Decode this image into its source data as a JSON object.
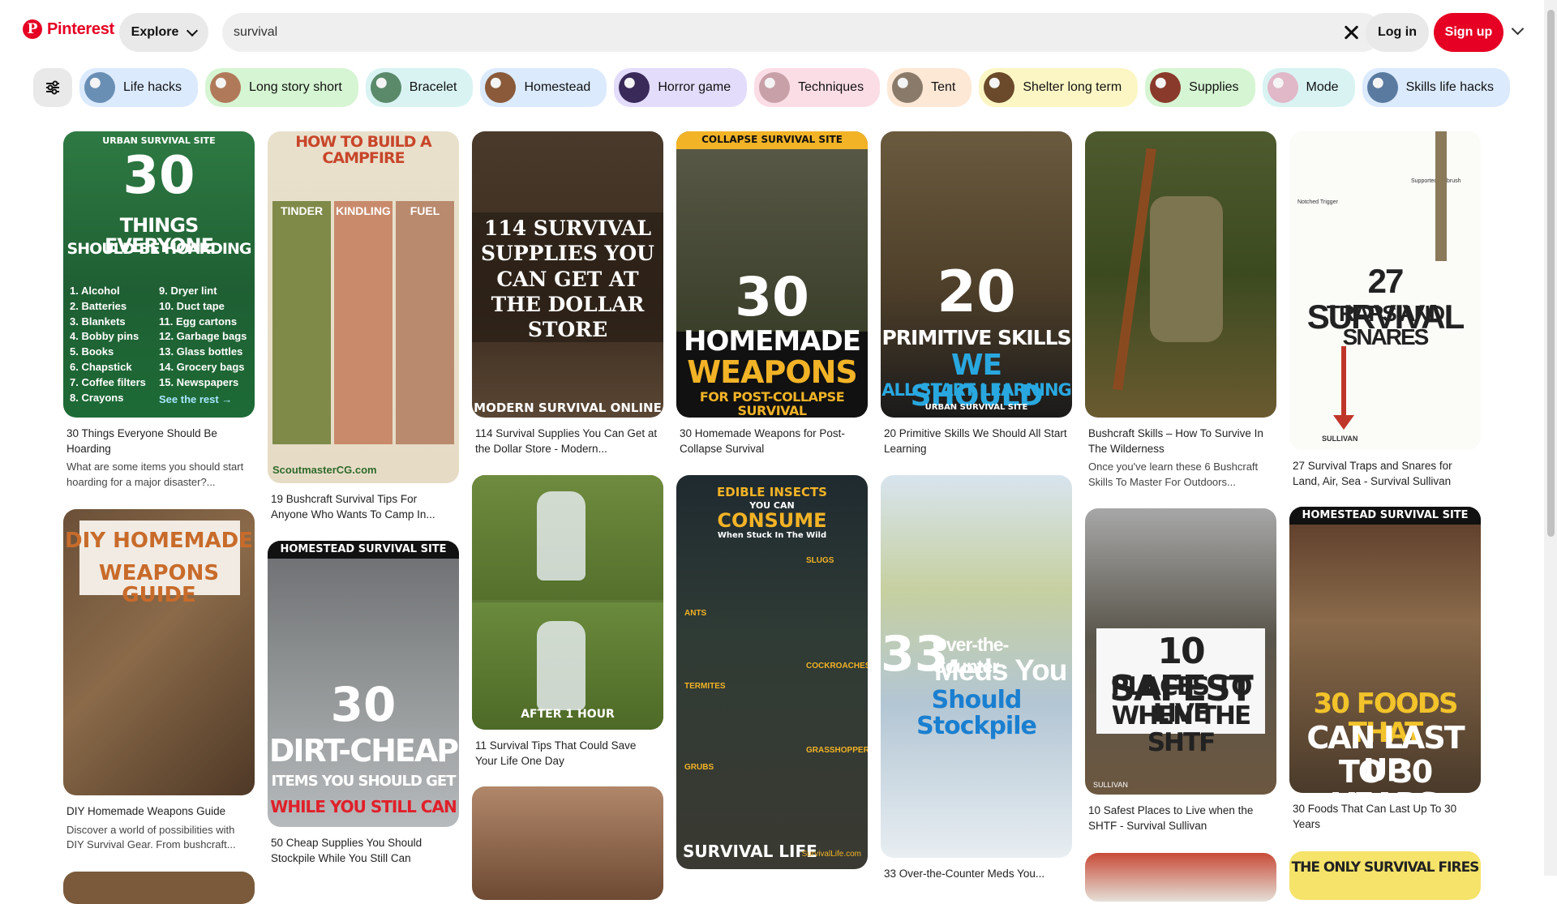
{
  "header": {
    "logo_glyph": "P",
    "logo_text": "Pinterest",
    "explore_label": "Explore",
    "search_value": "survival",
    "login_label": "Log in",
    "signup_label": "Sign up"
  },
  "chips": [
    {
      "label": "Life hacks",
      "bg": "#dbeafd"
    },
    {
      "label": "Long story short",
      "bg": "#d6f5d3"
    },
    {
      "label": "Bracelet",
      "bg": "#d9f3f3"
    },
    {
      "label": "Homestead",
      "bg": "#dbeafd"
    },
    {
      "label": "Horror game",
      "bg": "#e3dcfb"
    },
    {
      "label": "Techniques",
      "bg": "#fbdde6"
    },
    {
      "label": "Tent",
      "bg": "#fde8d6"
    },
    {
      "label": "Shelter long term",
      "bg": "#fbf6c4"
    },
    {
      "label": "Supplies",
      "bg": "#d6f5d3"
    },
    {
      "label": "Mode",
      "bg": "#d9f3f3"
    },
    {
      "label": "Skills life hacks",
      "bg": "#dbeafd"
    }
  ],
  "pins": {
    "p1": {
      "t1": "URBAN SURVIVAL SITE",
      "t2": "30",
      "t3": "THINGS EVERYONE",
      "t4": "SHOULD BE HOARDING",
      "l1": "1. Alcohol\n2. Batteries\n3. Blankets\n4. Bobby pins\n5. Books\n6. Chapstick\n7. Coffee filters\n8. Crayons",
      "l2": "9. Dryer lint\n10. Duct tape\n11. Egg cartons\n12. Garbage bags\n13. Glass bottles\n14. Grocery bags\n15. Newspapers",
      "more": "See the rest →",
      "title": "30 Things Everyone Should Be Hoarding",
      "desc": "What are some items you should start hoarding for a major disaster?..."
    },
    "p2": {
      "t1": "HOW TO BUILD A CAMPFIRE",
      "c1": "TINDER",
      "c2": "KINDLING",
      "c3": "FUEL",
      "foot": "ScoutmasterCG.com",
      "title": "19 Bushcraft Survival Tips For Anyone Who Wants To Camp In..."
    },
    "p3": {
      "t1": "114 SURVIVAL SUPPLIES YOU CAN GET AT THE DOLLAR STORE",
      "foot": "MODERN SURVIVAL ONLINE",
      "title": "114 Survival Supplies You Can Get at the Dollar Store - Modern..."
    },
    "p4": {
      "t1": "COLLAPSE SURVIVAL SITE",
      "t2": "30",
      "t3": "HOMEMADE",
      "t4": "WEAPONS",
      "t5": "FOR POST-COLLAPSE SURVIVAL",
      "title": "30 Homemade Weapons for Post-Collapse Survival"
    },
    "p5": {
      "t1": "20",
      "t2": "PRIMITIVE SKILLS",
      "t3": "WE SHOULD",
      "t4": "ALL START LEARNING",
      "t5": "URBAN SURVIVAL SITE",
      "title": "20 Primitive Skills We Should All Start Learning"
    },
    "p6": {
      "title": "Bushcraft Skills – How To Survive In The Wilderness",
      "desc": "Once you've learn these 6 Bushcraft Skills To Master For Outdoors..."
    },
    "p7": {
      "n1": "Notched Trigger",
      "n2": "Supported on brush",
      "t1": "27 SURVIVAL",
      "t2": "TRAPS AND SNARES",
      "foot": "SULLIVAN",
      "title": "27 Survival Traps and Snares for Land, Air, Sea - Survival Sullivan"
    },
    "p8": {
      "t1": "DIY HOMEMADE",
      "t2": "WEAPONS GUIDE",
      "title": "DIY Homemade Weapons Guide",
      "desc": "Discover a world of possibilities with DIY Survival Gear. From bushcraft..."
    },
    "p9": {
      "t1": "HOMESTEAD SURVIVAL SITE",
      "t2": "30",
      "t3": "DIRT-CHEAP",
      "t4": "ITEMS YOU SHOULD GET",
      "t5": "WHILE YOU STILL CAN",
      "title": "50 Cheap Supplies You Should Stockpile While You Still Can"
    },
    "p10": {
      "t1": "AFTER 1 HOUR",
      "title": "11 Survival Tips That Could Save Your Life One Day"
    },
    "p11": {
      "t1": "EDIBLE INSECTS",
      "t2": "YOU CAN",
      "t3": "CONSUME",
      "t4": "When Stuck In The Wild",
      "s1": "SLUGS",
      "s2": "ANTS",
      "s3": "COCKROACHES",
      "s4": "TERMITES",
      "s5": "GRASSHOPPERS",
      "s6": "GRUBS",
      "foot": "SURVIVAL LIFE",
      "site": "SurvivalLife.com"
    },
    "p12": {
      "t1": "33",
      "t2": "Over-the-Counter",
      "t3": "Meds You",
      "t4": "Should Stockpile",
      "title": "33 Over-the-Counter Meds You..."
    },
    "p13": {
      "t1": "10 SAFEST",
      "t2": "PLACES TO LIVE",
      "t3": "WHEN THE SHTF",
      "foot": "SULLIVAN",
      "title": "10 Safest Places to Live when the SHTF - Survival Sullivan"
    },
    "p14": {
      "t1": "HOMESTEAD SURVIVAL SITE",
      "t2": "30 FOODS THAT",
      "t3": "CAN LAST UP",
      "t4": "TO 30 YEARS",
      "title": "30 Foods That Can Last Up To 30 Years"
    },
    "p15": {
      "t1": "THE ONLY SURVIVAL FIRES"
    }
  }
}
